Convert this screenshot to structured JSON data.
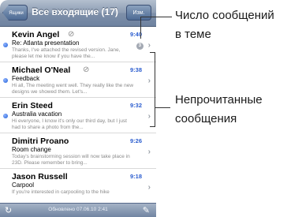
{
  "navbar": {
    "back_label": "Ящики",
    "title": "Все входящие (17)",
    "edit_label": "Изм."
  },
  "messages": [
    {
      "sender": "Kevin Angel",
      "has_attachment": true,
      "time": "9:40",
      "subject": "Re: Atlanta presentation",
      "preview": "Thanks, I've attached the revised version. Jane, please let me know if you have the...",
      "thread_count": "3",
      "unread": true
    },
    {
      "sender": "Michael O'Neal",
      "has_attachment": true,
      "time": "9:38",
      "subject": "Feedback",
      "preview": "Hi all, The meeting went well. They really like the new designs we showed them. Let's...",
      "unread": true
    },
    {
      "sender": "Erin Steed",
      "has_attachment": false,
      "time": "9:32",
      "subject": "Australia vacation",
      "preview": "Hi everyone, I know it's only our third day, but I just had to share a photo from the...",
      "unread": true
    },
    {
      "sender": "Dimitri Proano",
      "has_attachment": false,
      "time": "9:26",
      "subject": "Room change",
      "preview": "Today's brainstorming session will now take place in 23D. Please remember to bring...",
      "unread": false
    },
    {
      "sender": "Jason Russell",
      "has_attachment": false,
      "time": "9:18",
      "subject": "Carpool",
      "preview": "If you're interested in carpooling to the hike",
      "unread": false
    }
  ],
  "toolbar": {
    "updated_text": "Обновлено 07.06.10 2:41"
  },
  "callouts": {
    "thread_count_line1": "Число сообщений",
    "thread_count_line2": "в теме",
    "unread_line1": "Непрочитанные",
    "unread_line2": "сообщения"
  },
  "icons": {
    "attachment": "paperclip-icon",
    "refresh": "refresh-icon",
    "compose": "compose-icon",
    "chevron": "chevron-right-icon"
  },
  "colors": {
    "navbar": "#8d9db3",
    "unread_dot": "#1f5fd6",
    "time": "#2b5dcf"
  }
}
